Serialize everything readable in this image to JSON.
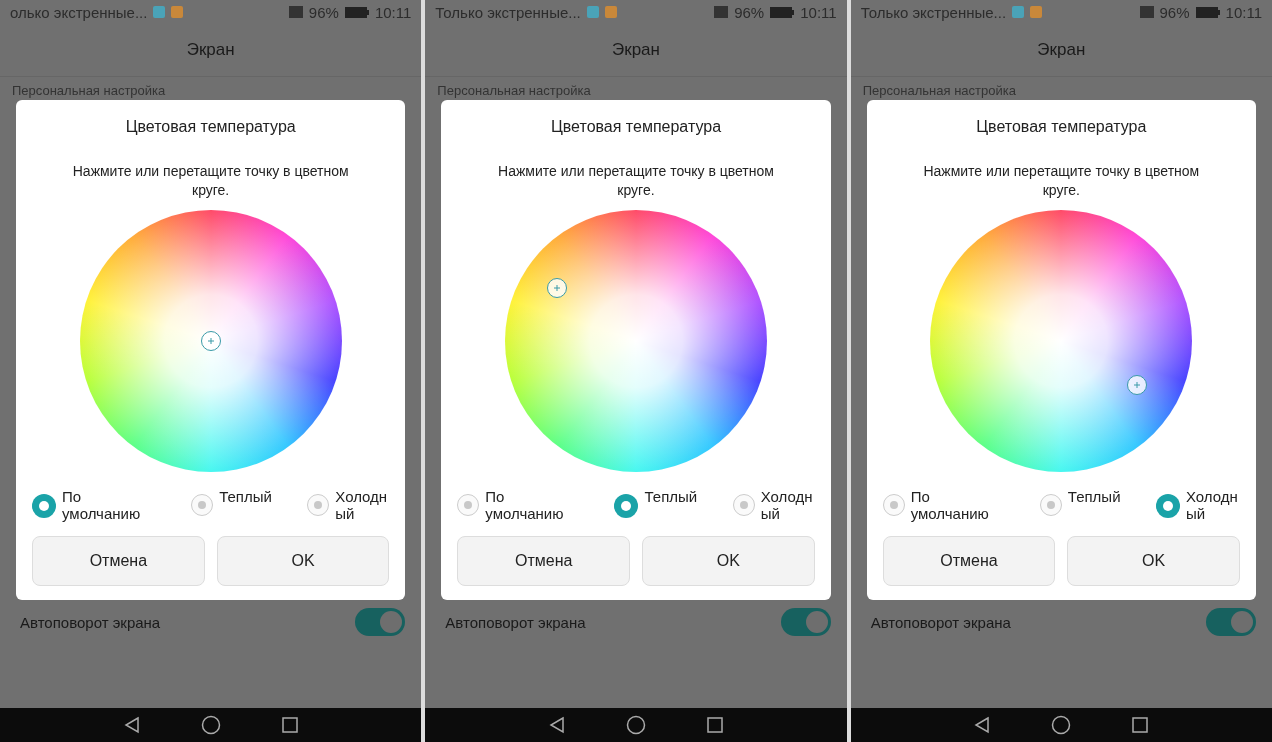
{
  "panels": [
    {
      "status": {
        "notification": "олько экстренные...",
        "battery": "96%",
        "time": "10:11"
      },
      "header": "Экран",
      "section": "Персональная настройка",
      "dialog": {
        "title": "Цветовая температура",
        "hint": "Нажмите или перетащите точку в цветном круге.",
        "options": [
          {
            "label": "По умолчанию",
            "selected": true
          },
          {
            "label": "Теплый",
            "selected": false
          },
          {
            "label": "Холодный",
            "selected": false
          }
        ],
        "buttons": [
          "Отмена",
          "OK"
        ]
      },
      "setting": {
        "label": "Автоповорот экрана",
        "on": true
      }
    },
    {
      "status": {
        "notification": "Только экстренные...",
        "battery": "96%",
        "time": "10:11"
      },
      "header": "Экран",
      "section": "Персональная настройка",
      "dialog": {
        "title": "Цветовая температура",
        "hint": "Нажмите или перетащите точку в цветном круге.",
        "options": [
          {
            "label": "По умолчанию",
            "selected": false
          },
          {
            "label": "Теплый",
            "selected": true
          },
          {
            "label": "Холодный",
            "selected": false
          }
        ],
        "buttons": [
          "Отмена",
          "OK"
        ]
      },
      "setting": {
        "label": "Автоповорот экрана",
        "on": true
      }
    },
    {
      "status": {
        "notification": "Только экстренные...",
        "battery": "96%",
        "time": "10:11"
      },
      "header": "Экран",
      "section": "Персональная настройка",
      "dialog": {
        "title": "Цветовая температура",
        "hint": "Нажмите или перетащите точку в цветном круге.",
        "options": [
          {
            "label": "По умолчанию",
            "selected": false
          },
          {
            "label": "Теплый",
            "selected": false
          },
          {
            "label": "Холодный",
            "selected": true
          }
        ],
        "buttons": [
          "Отмена",
          "OK"
        ]
      },
      "setting": {
        "label": "Автоповорот экрана",
        "on": true
      }
    }
  ]
}
